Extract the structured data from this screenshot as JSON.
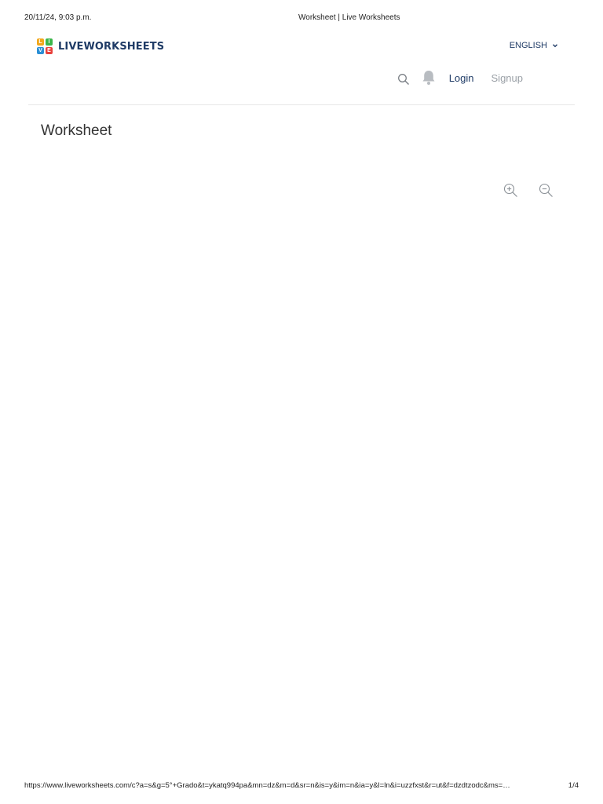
{
  "print_header": {
    "datetime": "20/11/24, 9:03 p.m.",
    "doc_title": "Worksheet | Live Worksheets"
  },
  "header": {
    "logo_letters": [
      "L",
      "I",
      "V",
      "E"
    ],
    "logo_colors": [
      "#f2a71b",
      "#3bb54a",
      "#2a8fd6",
      "#e8413c"
    ],
    "logo_text": "LIVEWORKSHEETS",
    "language": "ENGLISH",
    "nav": {
      "login": "Login",
      "signup": "Signup"
    },
    "icons": {
      "search": "search-icon",
      "notifications": "bell-icon",
      "language_dropdown": "chevron-down-icon"
    }
  },
  "main": {
    "title": "Worksheet",
    "zoom": {
      "zoom_in": "zoom-in-icon",
      "zoom_out": "zoom-out-icon"
    }
  },
  "print_footer": {
    "url": "https://www.liveworksheets.com/c?a=s&g=5°+Grado&t=ykatq994pa&mn=dz&m=d&sr=n&is=y&im=n&ia=y&l=ln&i=uzzfxst&r=ut&f=dzdtzodc&ms=…",
    "page": "1/4"
  },
  "colors": {
    "brand_navy": "#1f3b66",
    "muted_gray": "#9aa0a6",
    "divider": "#e6e6e6"
  }
}
